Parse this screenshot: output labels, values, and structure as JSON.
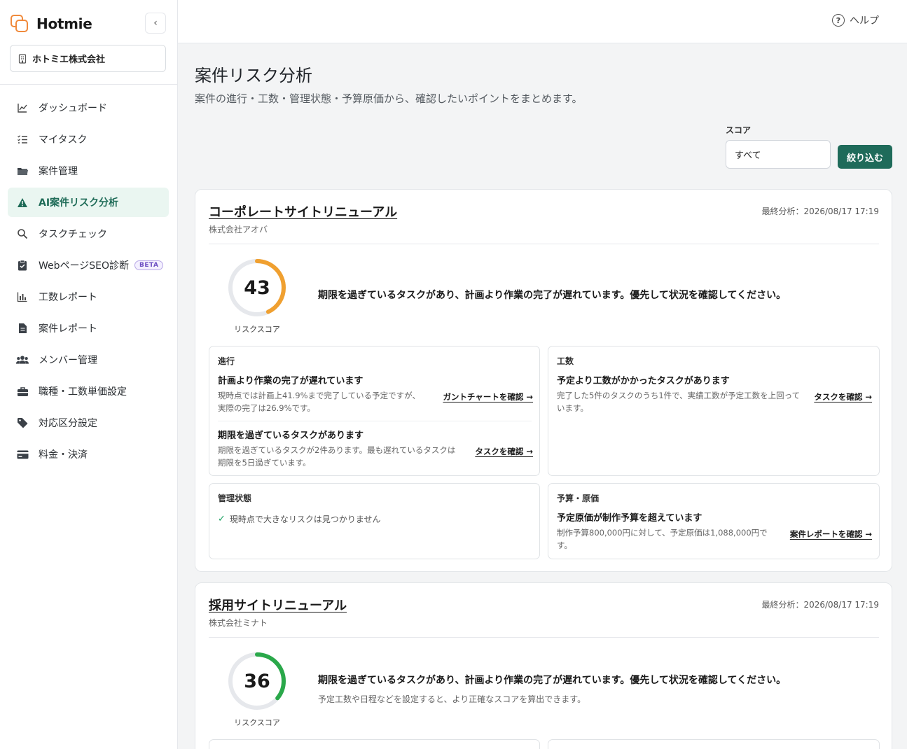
{
  "app": {
    "brand": "Hotmie",
    "company": "ホトミエ株式会社"
  },
  "sidebar": {
    "items": [
      {
        "label": "ダッシュボード",
        "icon": "chart-line-icon"
      },
      {
        "label": "マイタスク",
        "icon": "task-list-icon"
      },
      {
        "label": "案件管理",
        "icon": "folder-icon"
      },
      {
        "label": "AI案件リスク分析",
        "icon": "warning-icon",
        "active": true
      },
      {
        "label": "タスクチェック",
        "icon": "search-icon"
      },
      {
        "label": "WebページSEO診断",
        "icon": "clipboard-check-icon",
        "badge": "BETA"
      },
      {
        "label": "工数レポート",
        "icon": "bar-chart-icon"
      },
      {
        "label": "案件レポート",
        "icon": "document-icon"
      },
      {
        "label": "メンバー管理",
        "icon": "users-icon"
      },
      {
        "label": "職種・工数単価設定",
        "icon": "briefcase-icon"
      },
      {
        "label": "対応区分設定",
        "icon": "tag-icon"
      },
      {
        "label": "料金・決済",
        "icon": "credit-card-icon"
      }
    ]
  },
  "topbar": {
    "help": "ヘルプ"
  },
  "page": {
    "title": "案件リスク分析",
    "subtitle": "案件の進行・工数・管理状態・予算原価から、確認したいポイントをまとめます。",
    "filter": {
      "label": "スコア",
      "value": "すべて",
      "button": "絞り込む"
    }
  },
  "projects": [
    {
      "title": "コーポレートサイトリニューアル",
      "client": "株式会社アオバ",
      "analyzed": "最終分析：2026/08/17 17:19",
      "score": 43,
      "score_label": "リスクスコア",
      "score_color": "#f0a030",
      "summary": "期限を過ぎているタスクがあり、計画より作業の完了が遅れています。優先して状況を確認してください。",
      "sections": {
        "progress": {
          "heading": "進行",
          "items": [
            {
              "title": "計画より作業の完了が遅れています",
              "desc": "現時点では計画上41.9%まで完了している予定ですが、実際の完了は26.9%です。",
              "link": "ガントチャートを確認 →"
            },
            {
              "title": "期限を過ぎているタスクがあります",
              "desc": "期限を過ぎているタスクが2件あります。最も遅れているタスクは期限を5日過ぎています。",
              "link": "タスクを確認 →"
            }
          ]
        },
        "effort": {
          "heading": "工数",
          "items": [
            {
              "title": "予定より工数がかかったタスクがあります",
              "desc": "完了した5件のタスクのうち1件で、実績工数が予定工数を上回っています。",
              "link": "タスクを確認 →"
            }
          ]
        },
        "management": {
          "heading": "管理状態",
          "ok": "現時点で大きなリスクは見つかりません"
        },
        "budget": {
          "heading": "予算・原価",
          "items": [
            {
              "title": "予定原価が制作予算を超えています",
              "desc": "制作予算800,000円に対して、予定原価は1,088,000円です。",
              "link": "案件レポートを確認 →"
            }
          ]
        }
      }
    },
    {
      "title": "採用サイトリニューアル",
      "client": "株式会社ミナト",
      "analyzed": "最終分析：2026/08/17 17:19",
      "score": 36,
      "score_label": "リスクスコア",
      "score_color": "#2aa84a",
      "summary": "期限を過ぎているタスクがあり、計画より作業の完了が遅れています。優先して状況を確認してください。",
      "note": "予定工数や日程などを設定すると、より正確なスコアを算出できます。"
    }
  ]
}
